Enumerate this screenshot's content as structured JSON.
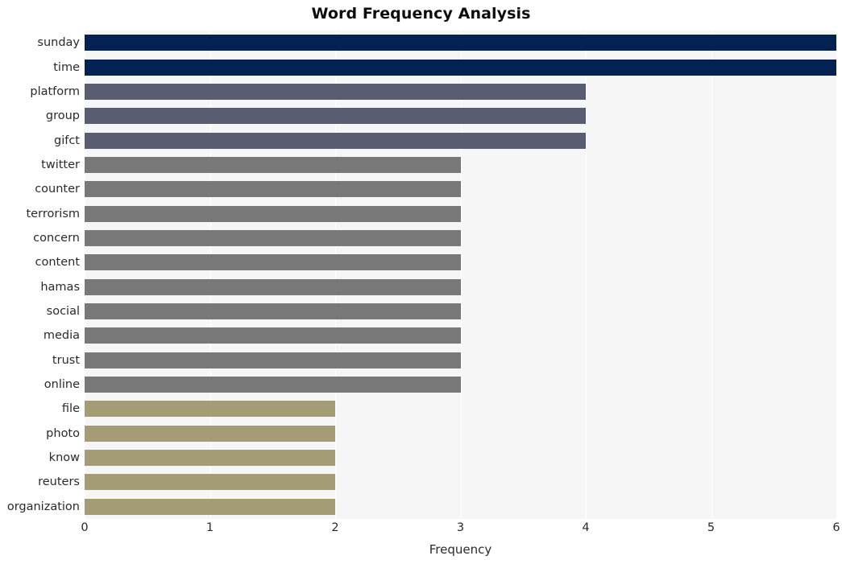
{
  "chart_data": {
    "type": "bar",
    "orientation": "horizontal",
    "title": "Word Frequency Analysis",
    "xlabel": "Frequency",
    "ylabel": "",
    "xlim": [
      0,
      6
    ],
    "xticks": [
      0,
      1,
      2,
      3,
      4,
      5,
      6
    ],
    "xtick_labels": [
      "0",
      "1",
      "2",
      "3",
      "4",
      "5",
      "6"
    ],
    "grid": "vertical-white",
    "legend": "none",
    "categories": [
      "sunday",
      "time",
      "platform",
      "group",
      "gifct",
      "twitter",
      "counter",
      "terrorism",
      "concern",
      "content",
      "hamas",
      "social",
      "media",
      "trust",
      "online",
      "file",
      "photo",
      "know",
      "reuters",
      "organization"
    ],
    "values": [
      6,
      6,
      4,
      4,
      4,
      3,
      3,
      3,
      3,
      3,
      3,
      3,
      3,
      3,
      3,
      2,
      2,
      2,
      2,
      2
    ],
    "bar_colors": [
      "#042154",
      "#042154",
      "#595d72",
      "#595d72",
      "#595d72",
      "#787878",
      "#787878",
      "#787878",
      "#787878",
      "#787878",
      "#787878",
      "#787878",
      "#787878",
      "#787878",
      "#787878",
      "#a49c75",
      "#a49c75",
      "#a49c75",
      "#a49c75",
      "#a49c75"
    ]
  },
  "colors": {
    "figure_background": "#ffffff",
    "plot_background": "#f6f6f7",
    "gridline": "#ffffff",
    "title_text": "#0d0d0d",
    "tick_text": "#2a2a2a",
    "navy": "#042154",
    "slate": "#595d72",
    "gray": "#787878",
    "khaki": "#a49c75"
  }
}
